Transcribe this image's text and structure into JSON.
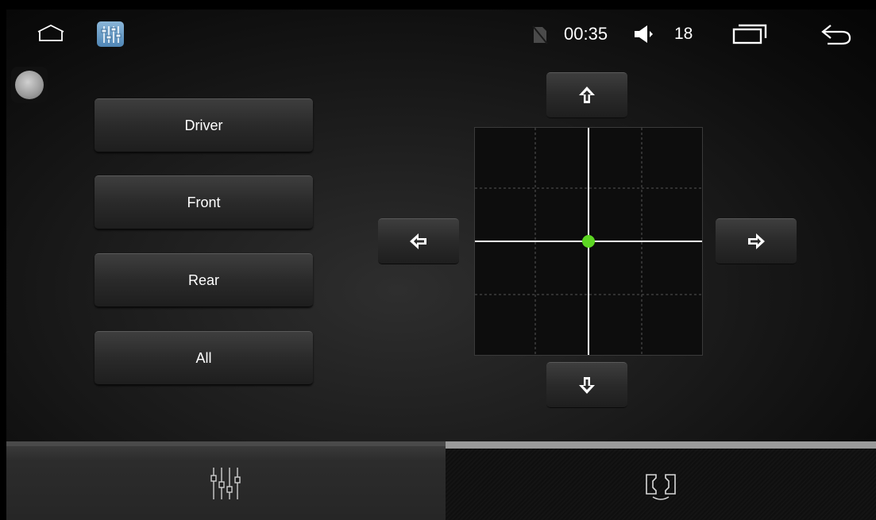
{
  "status_bar": {
    "time": "00:35",
    "volume": "18",
    "icons": [
      "home-icon",
      "equalizer-app-icon",
      "no-sim-icon",
      "volume-icon",
      "recent-apps-icon",
      "back-icon"
    ]
  },
  "zones": [
    {
      "label": "Driver"
    },
    {
      "label": "Front"
    },
    {
      "label": "Rear"
    },
    {
      "label": "All"
    }
  ],
  "balance": {
    "arrows": [
      "up-arrow-icon",
      "left-arrow-icon",
      "right-arrow-icon",
      "down-arrow-icon"
    ],
    "position": {
      "x": 0,
      "y": 0
    },
    "marker_color": "#5dd623"
  },
  "tabs": [
    {
      "icon": "equalizer-icon",
      "active": false
    },
    {
      "icon": "balance-fader-icon",
      "active": true
    }
  ],
  "colors": {
    "accent_marker": "#5dd623",
    "text": "#ffffff"
  }
}
